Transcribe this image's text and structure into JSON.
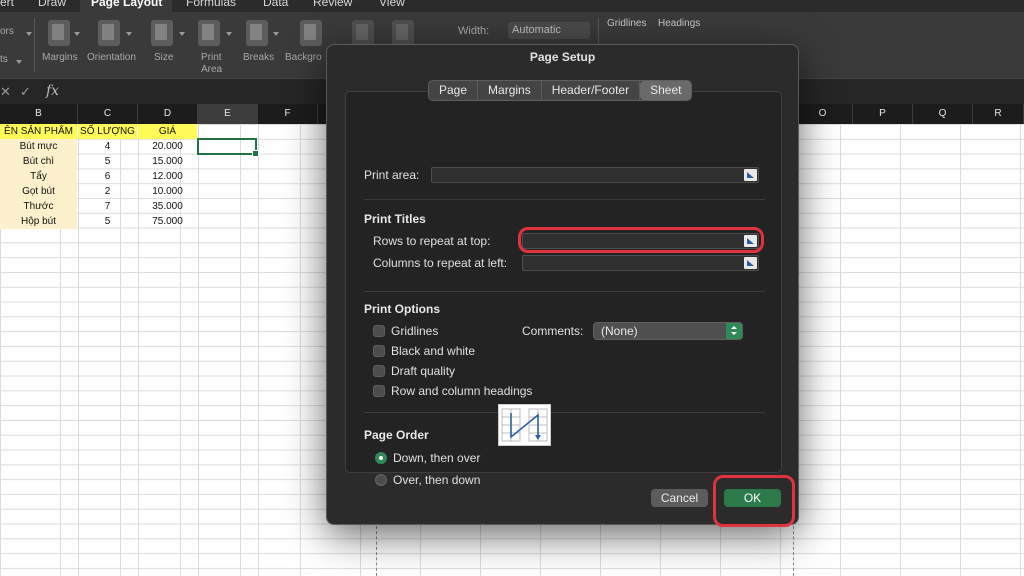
{
  "ribbon": {
    "tabs": [
      {
        "label": "ert",
        "active": false
      },
      {
        "label": "Draw",
        "active": false
      },
      {
        "label": "Page Layout",
        "active": true
      },
      {
        "label": "Formulas",
        "active": false
      },
      {
        "label": "Data",
        "active": false
      },
      {
        "label": "Review",
        "active": false
      },
      {
        "label": "View",
        "active": false
      }
    ],
    "left_clip_1": "ors",
    "left_clip_2": "ts",
    "buttons": {
      "margins": "Margins",
      "orientation": "Orientation",
      "size": "Size",
      "print_area_1": "Print",
      "print_area_2": "Area",
      "breaks": "Breaks",
      "background": "Backgro"
    },
    "width_label": "Width:",
    "width_value": "Automatic",
    "gridlines_label": "Gridlines",
    "headings_label": "Headings"
  },
  "formula_bar": {
    "fx": "fx"
  },
  "sheet": {
    "columns": [
      "B",
      "C",
      "D",
      "E",
      "F",
      "O",
      "P",
      "Q",
      "R"
    ],
    "headers": [
      "ÊN SẢN PHẨM",
      "SỐ LƯỢNG",
      "GIÁ"
    ],
    "rows": [
      [
        "Bút mực",
        "4",
        "20.000"
      ],
      [
        "Bút chì",
        "5",
        "15.000"
      ],
      [
        "Tẩy",
        "6",
        "12.000"
      ],
      [
        "Gọt bút",
        "2",
        "10.000"
      ],
      [
        "Thước",
        "7",
        "35.000"
      ],
      [
        "Hộp bút",
        "5",
        "75.000"
      ]
    ]
  },
  "dialog": {
    "title": "Page Setup",
    "tabs": [
      {
        "label": "Page",
        "active": false
      },
      {
        "label": "Margins",
        "active": false
      },
      {
        "label": "Header/Footer",
        "active": false
      },
      {
        "label": "Sheet",
        "active": true
      }
    ],
    "print_area_label": "Print area:",
    "print_area_value": "",
    "print_titles": {
      "heading": "Print Titles",
      "rows_label": "Rows to repeat at top:",
      "rows_value": "",
      "cols_label": "Columns to repeat at left:",
      "cols_value": ""
    },
    "print_options": {
      "heading": "Print Options",
      "gridlines": "Gridlines",
      "black_white": "Black and white",
      "draft": "Draft quality",
      "row_col_headings": "Row and column headings",
      "comments_label": "Comments:",
      "comments_value": "(None)"
    },
    "page_order": {
      "heading": "Page Order",
      "down_then_over": "Down, then over",
      "over_then_down": "Over, then down",
      "selected": "down_then_over"
    },
    "cancel": "Cancel",
    "ok": "OK"
  },
  "colors": {
    "accent_green": "#2c7a4a",
    "highlight_red": "#e0333b",
    "header_yellow": "#fffa55",
    "name_fill": "#fdf0cc"
  }
}
